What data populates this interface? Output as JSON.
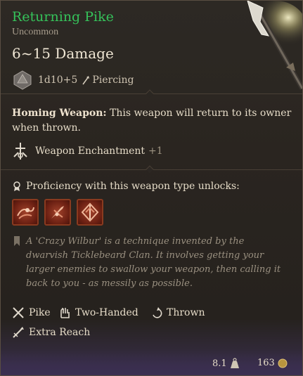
{
  "item": {
    "name": "Returning Pike",
    "rarity": "Uncommon",
    "damage": "6~15 Damage",
    "dice": "1d10+5",
    "damage_type": "Piercing"
  },
  "enchant_text": {
    "ability_name": "Homing Weapon:",
    "ability_desc": " This weapon will return to its owner when thrown.",
    "enchant_label": "Weapon Enchantment",
    "enchant_value": "+1"
  },
  "proficiency": {
    "label": "Proficiency with this weapon type unlocks:",
    "actions": [
      "action-1-icon",
      "action-2-icon",
      "action-3-icon"
    ]
  },
  "flavor": "A 'Crazy Wilbur' is a technique invented by the dwarvish Ticklebeard Clan. It involves getting your larger enemies to swallow your weapon, then calling it back to you - as messily as possible.",
  "properties": {
    "pike": "Pike",
    "two_handed": "Two-Handed",
    "thrown": "Thrown",
    "extra_reach": "Extra Reach"
  },
  "footer": {
    "weight": "8.1",
    "value": "163"
  },
  "colors": {
    "title_green": "#35c25a",
    "action_red": "#a0412a"
  }
}
